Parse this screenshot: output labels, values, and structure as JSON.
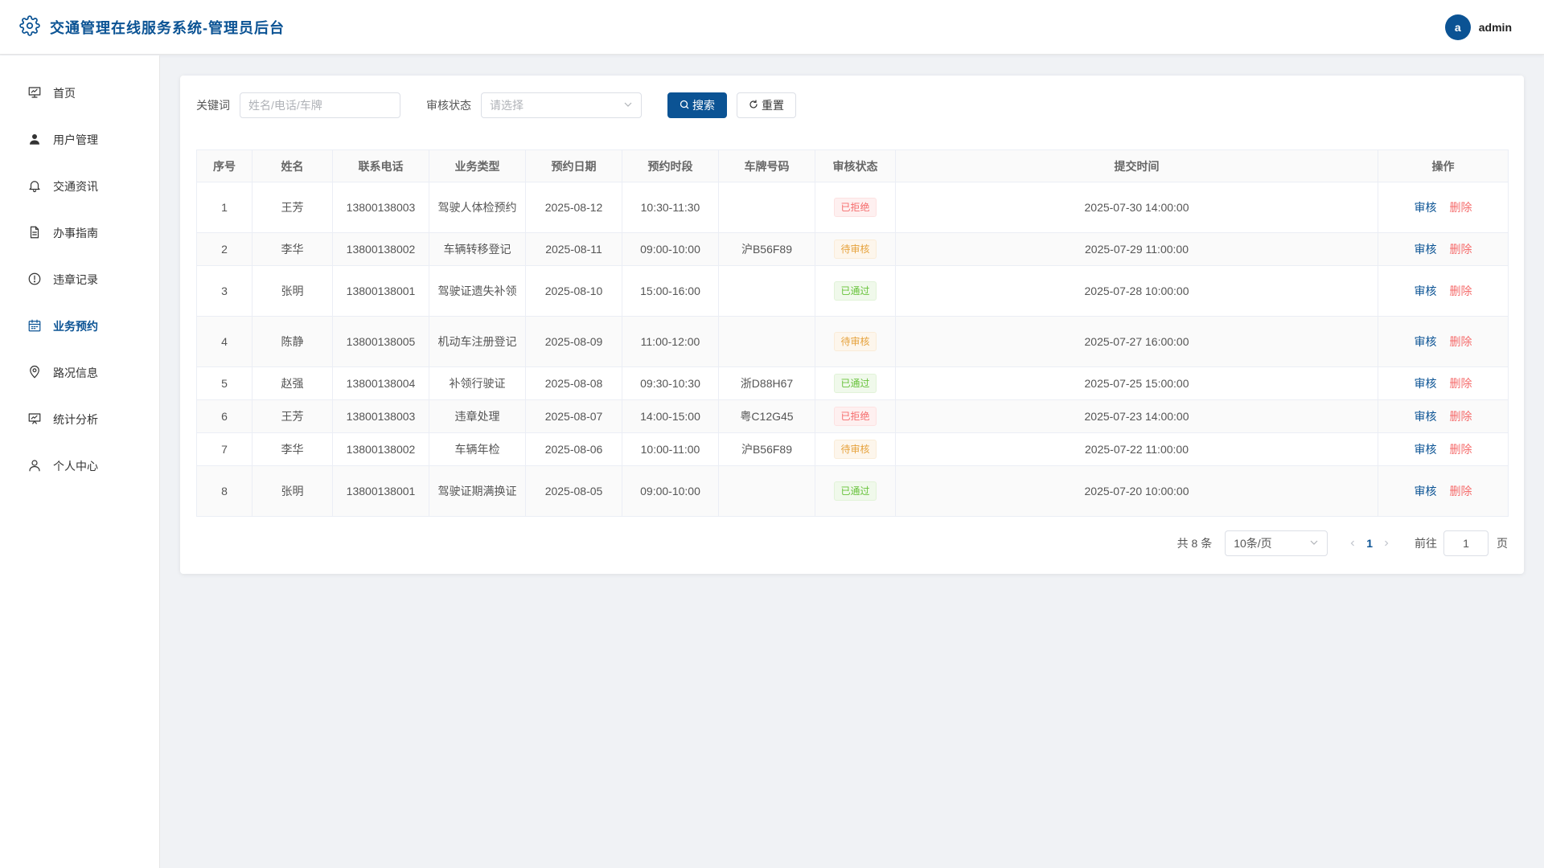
{
  "header": {
    "title": "交通管理在线服务系统-管理员后台",
    "avatar_letter": "a",
    "username": "admin"
  },
  "sidebar": {
    "items": [
      {
        "label": "首页",
        "icon": "presentation-icon"
      },
      {
        "label": "用户管理",
        "icon": "user-icon"
      },
      {
        "label": "交通资讯",
        "icon": "bell-icon"
      },
      {
        "label": "办事指南",
        "icon": "document-icon"
      },
      {
        "label": "违章记录",
        "icon": "warning-circle-icon"
      },
      {
        "label": "业务预约",
        "icon": "calendar-icon",
        "active": true
      },
      {
        "label": "路况信息",
        "icon": "location-pin-icon"
      },
      {
        "label": "统计分析",
        "icon": "chart-board-icon"
      },
      {
        "label": "个人中心",
        "icon": "person-outline-icon"
      }
    ]
  },
  "filters": {
    "keyword_label": "关键词",
    "keyword_placeholder": "姓名/电话/车牌",
    "status_label": "审核状态",
    "status_placeholder": "请选择",
    "search_label": "搜索",
    "reset_label": "重置"
  },
  "table": {
    "columns": [
      "序号",
      "姓名",
      "联系电话",
      "业务类型",
      "预约日期",
      "预约时段",
      "车牌号码",
      "审核状态",
      "提交时间",
      "操作"
    ],
    "rows": [
      {
        "no": "1",
        "name": "王芳",
        "phone": "13800138003",
        "type": "驾驶人体检预约",
        "date": "2025-08-12",
        "slot": "10:30-11:30",
        "plate": "",
        "status": "已拒绝",
        "status_kind": "reject",
        "submitted": "2025-07-30 14:00:00"
      },
      {
        "no": "2",
        "name": "李华",
        "phone": "13800138002",
        "type": "车辆转移登记",
        "date": "2025-08-11",
        "slot": "09:00-10:00",
        "plate": "沪B56F89",
        "status": "待审核",
        "status_kind": "pending",
        "submitted": "2025-07-29 11:00:00"
      },
      {
        "no": "3",
        "name": "张明",
        "phone": "13800138001",
        "type": "驾驶证遗失补领",
        "date": "2025-08-10",
        "slot": "15:00-16:00",
        "plate": "",
        "status": "已通过",
        "status_kind": "pass",
        "submitted": "2025-07-28 10:00:00"
      },
      {
        "no": "4",
        "name": "陈静",
        "phone": "13800138005",
        "type": "机动车注册登记",
        "date": "2025-08-09",
        "slot": "11:00-12:00",
        "plate": "",
        "status": "待审核",
        "status_kind": "pending",
        "submitted": "2025-07-27 16:00:00"
      },
      {
        "no": "5",
        "name": "赵强",
        "phone": "13800138004",
        "type": "补领行驶证",
        "date": "2025-08-08",
        "slot": "09:30-10:30",
        "plate": "浙D88H67",
        "status": "已通过",
        "status_kind": "pass",
        "submitted": "2025-07-25 15:00:00"
      },
      {
        "no": "6",
        "name": "王芳",
        "phone": "13800138003",
        "type": "违章处理",
        "date": "2025-08-07",
        "slot": "14:00-15:00",
        "plate": "粤C12G45",
        "status": "已拒绝",
        "status_kind": "reject",
        "submitted": "2025-07-23 14:00:00"
      },
      {
        "no": "7",
        "name": "李华",
        "phone": "13800138002",
        "type": "车辆年检",
        "date": "2025-08-06",
        "slot": "10:00-11:00",
        "plate": "沪B56F89",
        "status": "待审核",
        "status_kind": "pending",
        "submitted": "2025-07-22 11:00:00"
      },
      {
        "no": "8",
        "name": "张明",
        "phone": "13800138001",
        "type": "驾驶证期满换证",
        "date": "2025-08-05",
        "slot": "09:00-10:00",
        "plate": "",
        "status": "已通过",
        "status_kind": "pass",
        "submitted": "2025-07-20 10:00:00"
      }
    ],
    "audit_label": "审核",
    "delete_label": "删除"
  },
  "pagination": {
    "total_text": "共 8 条",
    "page_size": "10条/页",
    "current_page": "1",
    "goto_label": "前往",
    "goto_value": "1",
    "page_unit": "页"
  },
  "colors": {
    "primary": "#0b5394",
    "reject": "#f56c6c",
    "pending": "#e6a23c",
    "pass": "#67c23a"
  }
}
